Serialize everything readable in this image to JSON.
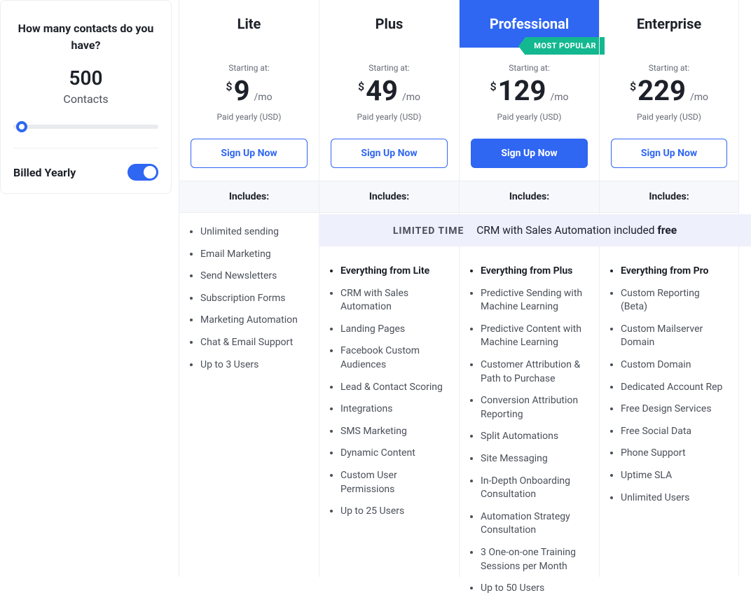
{
  "sidebar": {
    "heading": "How many contacts do you have?",
    "count": "500",
    "count_label": "Contacts",
    "billed_label": "Billed Yearly"
  },
  "common": {
    "starting": "Starting at:",
    "currency": "$",
    "period": "/mo",
    "paid_note": "Paid yearly (USD)",
    "cta": "Sign Up Now",
    "includes": "Includes:"
  },
  "limited_banner": {
    "label": "LIMITED TIME",
    "text": "CRM with Sales Automation included",
    "em": "free"
  },
  "plans": {
    "lite": {
      "name": "Lite",
      "price": "9"
    },
    "plus": {
      "name": "Plus",
      "price": "49"
    },
    "pro": {
      "name": "Professional",
      "price": "129",
      "badge": "MOST POPULAR"
    },
    "ent": {
      "name": "Enterprise",
      "price": "229"
    }
  },
  "features": {
    "lite": [
      "Unlimited sending",
      "Email Marketing",
      "Send Newsletters",
      "Subscription Forms",
      "Marketing Automation",
      "Chat & Email Support",
      "Up to 3 Users"
    ],
    "plus_lead": "Everything from Lite",
    "plus": [
      "CRM with Sales Automation",
      "Landing Pages",
      "Facebook Custom Audiences",
      "Lead & Contact Scoring",
      "Integrations",
      "SMS Marketing",
      "Dynamic Content",
      "Custom User Permissions",
      "Up to 25 Users"
    ],
    "pro_lead": "Everything from Plus",
    "pro": [
      "Predictive Sending with Machine Learning",
      "Predictive Content with Machine Learning",
      "Customer Attribution & Path to Purchase",
      "Conversion Attribution Reporting",
      "Split Automations",
      "Site Messaging",
      "In-Depth Onboarding Consultation",
      "Automation Strategy Consultation",
      "3 One-on-one Training Sessions per Month",
      "Up to 50 Users"
    ],
    "ent_lead": "Everything from Pro",
    "ent": [
      "Custom Reporting (Beta)",
      "Custom Mailserver Domain",
      "Custom Domain",
      "Dedicated Account Rep",
      "Free Design Services",
      "Free Social Data",
      "Phone Support",
      "Uptime SLA",
      "Unlimited Users"
    ]
  }
}
